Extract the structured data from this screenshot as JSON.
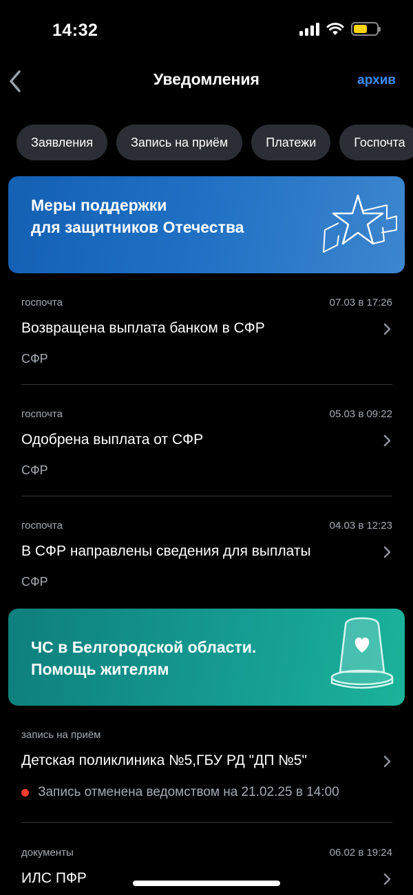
{
  "status_bar": {
    "time": "14:32"
  },
  "nav": {
    "title": "Уведомления",
    "archive_label": "архив"
  },
  "chips": [
    "Заявления",
    "Запись на приём",
    "Платежи",
    "Госпочта"
  ],
  "banners": {
    "defenders": {
      "line1": "Меры поддержки",
      "line2": "для защитников Отечества"
    },
    "belgorod": {
      "line1": "ЧС в Белгородской области.",
      "line2": "Помощь жителям"
    }
  },
  "notifications": [
    {
      "source": "госпочта",
      "date": "07.03 в 17:26",
      "title": "Возвращена выплата банком в СФР",
      "org": "СФР"
    },
    {
      "source": "госпочта",
      "date": "05.03 в 09:22",
      "title": "Одобрена выплата от СФР",
      "org": "СФР"
    },
    {
      "source": "госпочта",
      "date": "04.03 в 12:23",
      "title": "В СФР направлены сведения для выплаты",
      "org": "СФР"
    },
    {
      "source": "запись на приём",
      "title": "Детская поликлиника №5,ГБУ РД \"ДП №5\"",
      "status": "Запись отменена ведомством на 21.02.25 в 14:00"
    },
    {
      "source": "документы",
      "date": "06.02 в 19:24",
      "title": "ИЛС ПФР"
    }
  ],
  "colors": {
    "accent": "#3d8df5",
    "status_dot": "#ff3b30",
    "battery": "#ffd60a"
  },
  "icons": [
    "signal-icon",
    "wifi-icon",
    "battery-icon",
    "back-chevron-icon",
    "chevron-right-icon",
    "star-icon",
    "beacon-icon"
  ]
}
